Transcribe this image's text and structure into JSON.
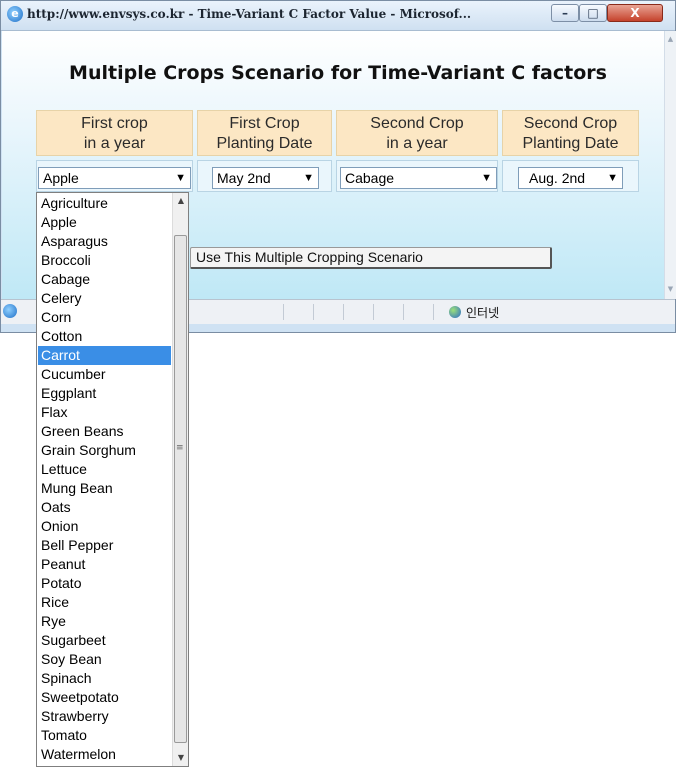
{
  "window": {
    "title": "http://www.envsys.co.kr - Time-Variant C Factor Value - Microsof...",
    "min_glyph": "–",
    "max_glyph": "□",
    "close_glyph": "X"
  },
  "heading": "Multiple Crops Scenario for Time-Variant C factors",
  "columns": [
    {
      "line1": "First crop",
      "line2": "in a year"
    },
    {
      "line1": "First Crop",
      "line2": "Planting Date"
    },
    {
      "line1": "Second Crop",
      "line2": "in a year"
    },
    {
      "line1": "Second Crop",
      "line2": "Planting Date"
    }
  ],
  "selects": {
    "first_crop": "Apple",
    "first_date": "May 2nd",
    "second_crop": "Cabage",
    "second_date": "Aug. 2nd"
  },
  "button_label": "Use This Multiple Cropping Scenario",
  "statusbar": {
    "zone": "인터넷"
  },
  "dropdown": {
    "selected": "Carrot",
    "options": [
      "Agriculture",
      "Apple",
      "Asparagus",
      "Broccoli",
      "Cabage",
      "Celery",
      "Corn",
      "Cotton",
      "Carrot",
      "Cucumber",
      "Eggplant",
      "Flax",
      "Green Beans",
      "Grain Sorghum",
      "Lettuce",
      "Mung Bean",
      "Oats",
      "Onion",
      "Bell Pepper",
      "Peanut",
      "Potato",
      "Rice",
      "Rye",
      "Sugarbeet",
      "Soy Bean",
      "Spinach",
      "Sweetpotato",
      "Strawberry",
      "Tomato",
      "Watermelon"
    ]
  },
  "icons": {
    "dropdown_arrow": "chevron-down-icon",
    "browser": "ie-icon",
    "zone": "globe-icon"
  }
}
